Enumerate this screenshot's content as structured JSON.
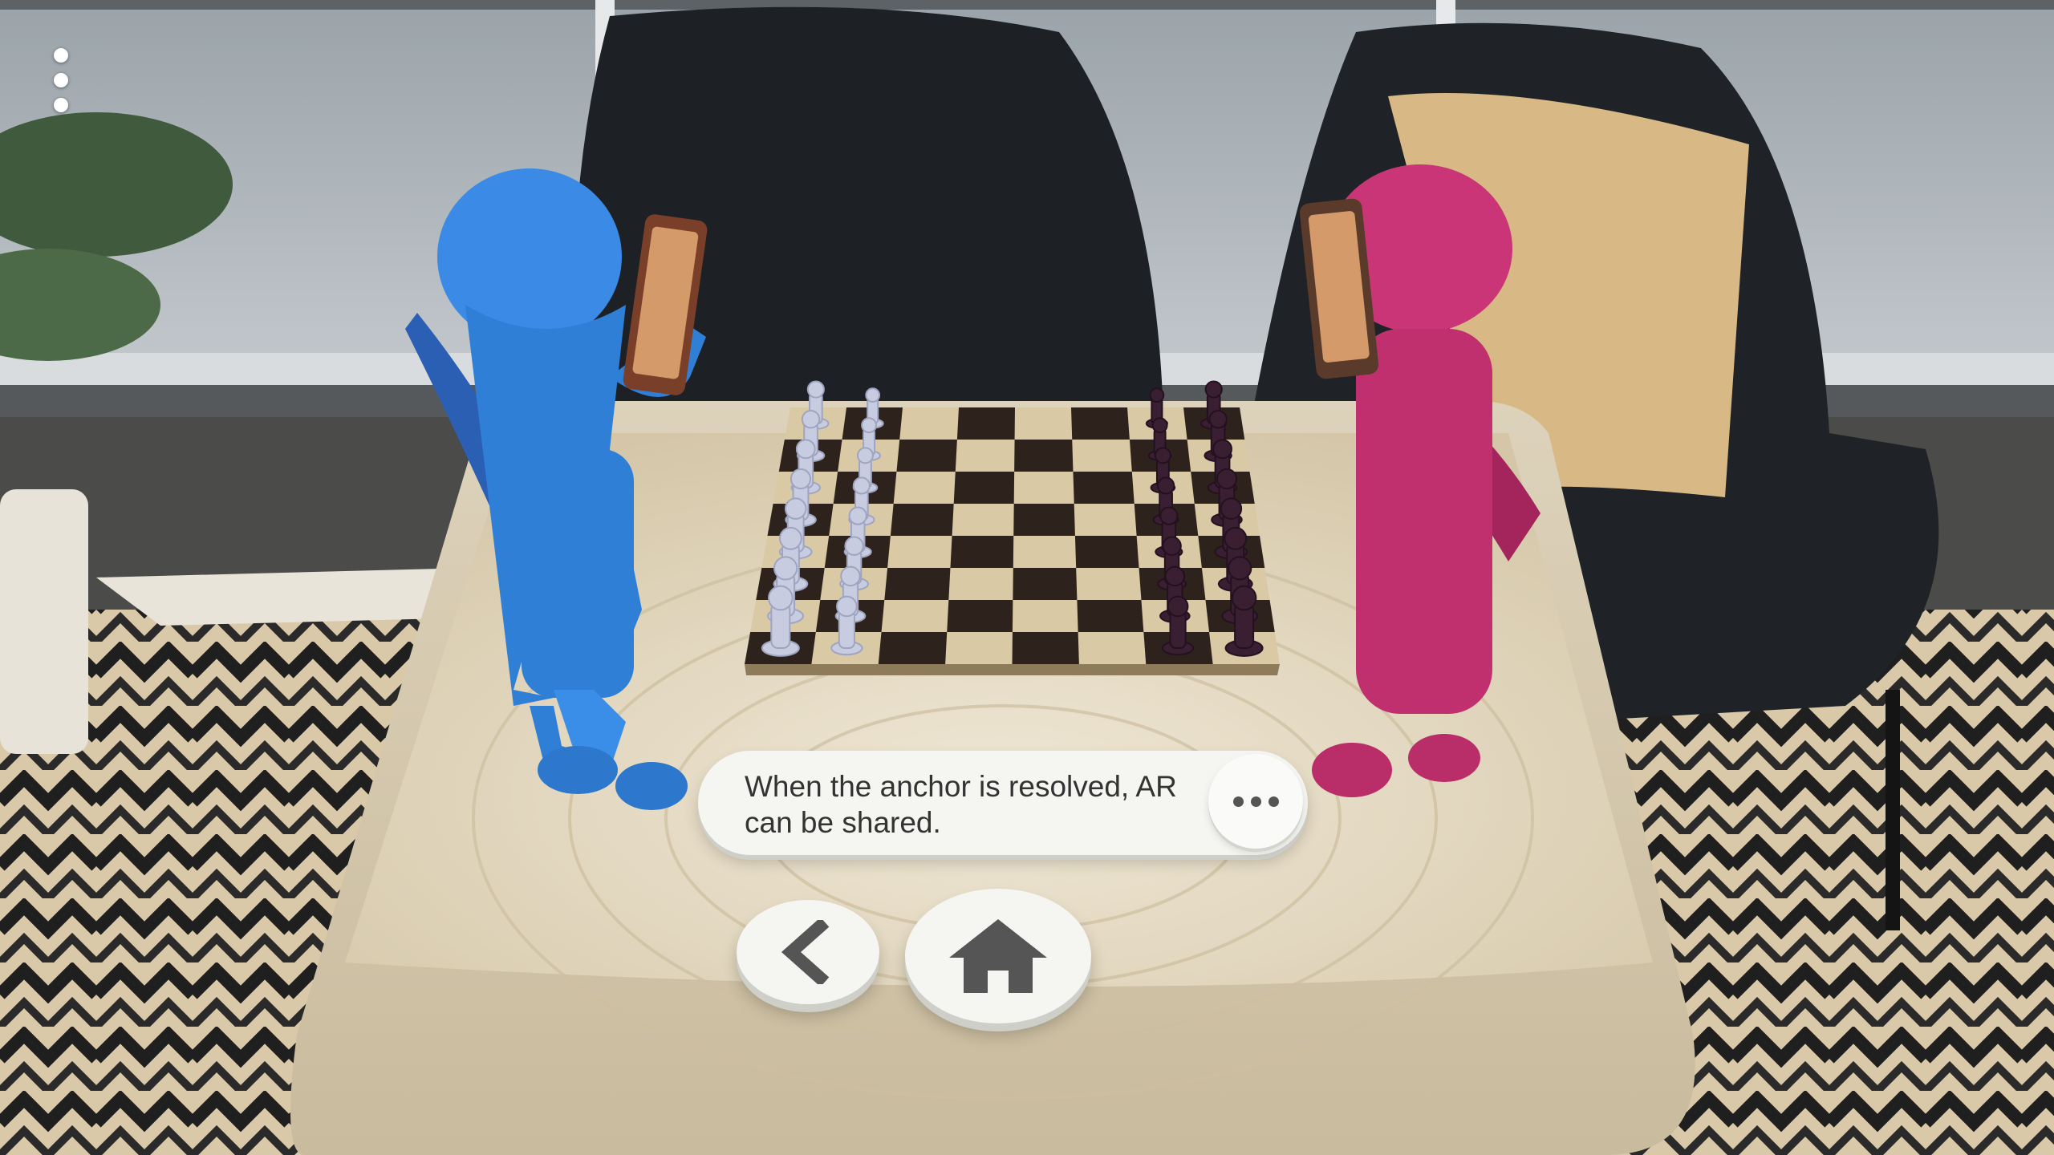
{
  "overlay": {
    "message": "When the anchor is resolved, AR can be shared."
  },
  "icons": {
    "menu": "more-vert-icon",
    "more": "more-horiz-icon",
    "back": "chevron-left-icon",
    "home": "home-icon"
  },
  "colors": {
    "blue_character": "#2f7fd6",
    "pink_character": "#c0306e",
    "light_pieces": "#c8cce0",
    "dark_pieces": "#3a1f33",
    "bubble": "#f5f5f2",
    "icon": "#555555"
  }
}
